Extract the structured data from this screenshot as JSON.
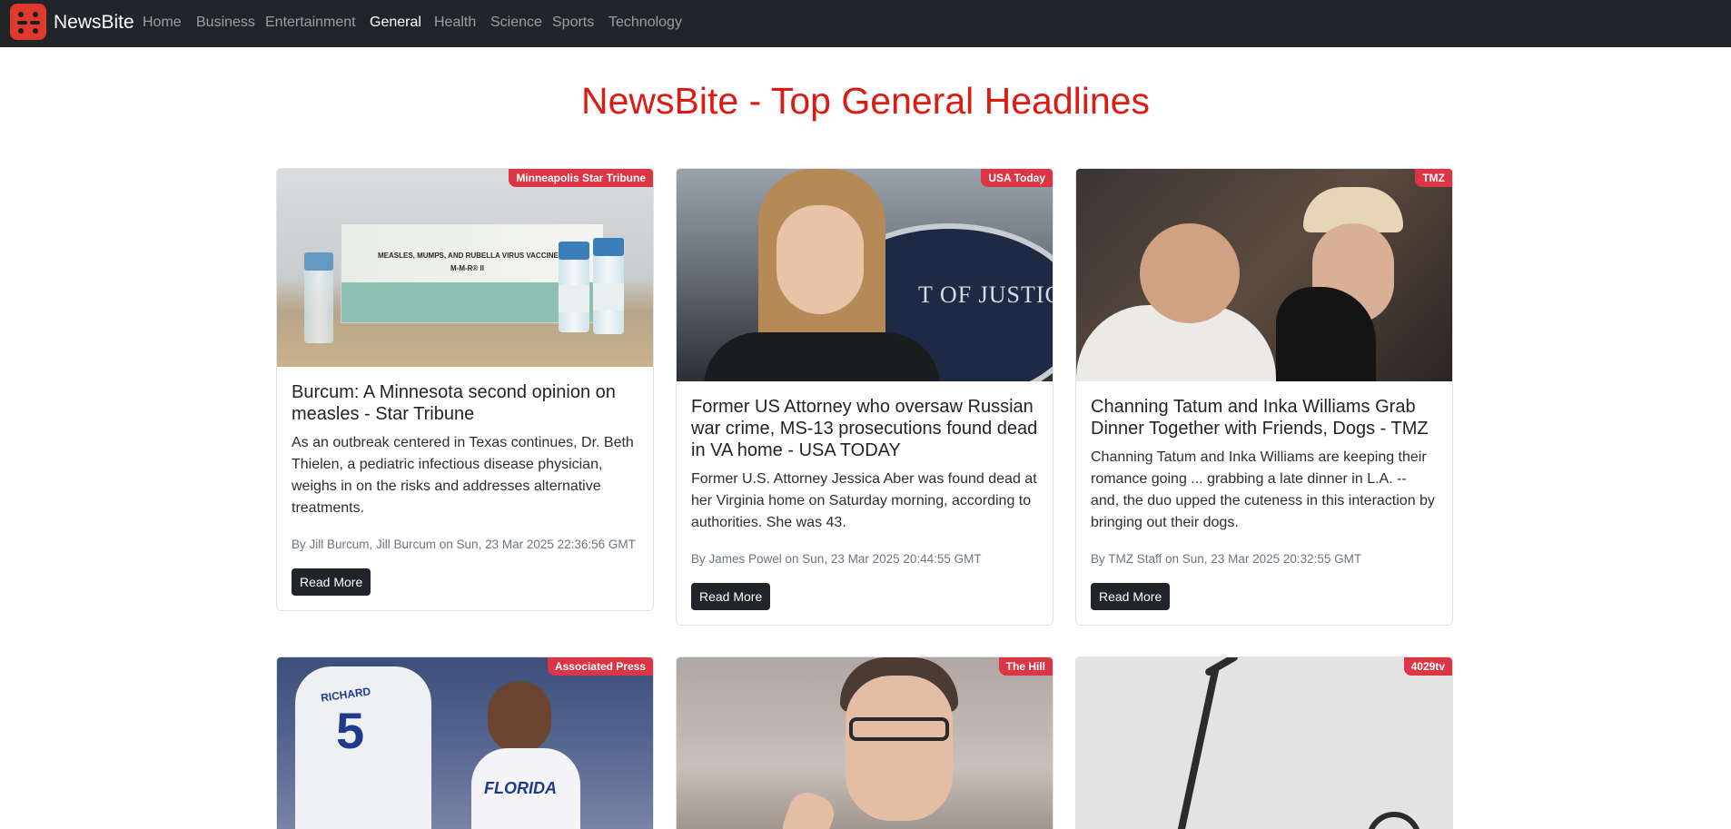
{
  "nav": {
    "brand": "NewsBite",
    "links": [
      "Home",
      "Business",
      "Entertainment",
      "General",
      "Health",
      "Science",
      "Sports",
      "Technology"
    ],
    "active": "General"
  },
  "page": {
    "title": "NewsBite - Top General Headlines"
  },
  "articles": [
    {
      "source": "Minneapolis Star Tribune",
      "title": "Burcum: A Minnesota second opinion on measles - Star Tribune",
      "description": "As an outbreak centered in Texas continues, Dr. Beth Thielen, a pediatric infectious disease physician, weighs in on the risks and addresses alternative treatments.",
      "meta": "By Jill Burcum, Jill Burcum on Sun, 23 Mar 2025 22:36:56 GMT",
      "button": "Read More",
      "image_caption": "MEASLES, MUMPS, AND RUBELLA VIRUS VACCINE LIVE",
      "image_caption2": "M-M-R® II"
    },
    {
      "source": "USA Today",
      "title": "Former US Attorney who oversaw Russian war crime, MS-13 prosecutions found dead in VA home - USA TODAY",
      "description": "Former U.S. Attorney Jessica Aber was found dead at her Virginia home on Saturday morning, according to authorities. She was 43.",
      "meta": "By James Powel on Sun, 23 Mar 2025 20:44:55 GMT",
      "button": "Read More",
      "image_caption": "T OF JUSTIC"
    },
    {
      "source": "TMZ",
      "title": "Channing Tatum and Inka Williams Grab Dinner Together with Friends, Dogs - TMZ",
      "description": "Channing Tatum and Inka Williams are keeping their romance going ... grabbing a late dinner in L.A. -- and, the duo upped the cuteness in this interaction by bringing out their dogs.",
      "meta": "By TMZ Staff on Sun, 23 Mar 2025 20:32:55 GMT",
      "button": "Read More"
    },
    {
      "source": "Associated Press",
      "image_caption": "FLORIDA",
      "image_caption2": "RICHARD",
      "image_caption3": "5"
    },
    {
      "source": "The Hill"
    },
    {
      "source": "4029tv"
    }
  ],
  "colors": {
    "navbar": "#212529",
    "accent": "#dc1c13",
    "badge": "#dc3545"
  },
  "icons": {
    "brand": "dice-logo-icon"
  }
}
